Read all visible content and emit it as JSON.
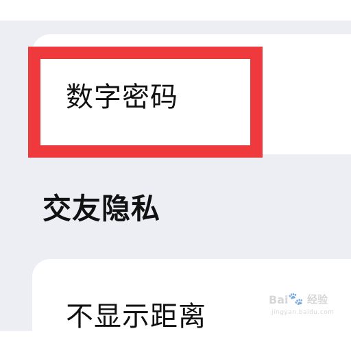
{
  "privacy_settings": {
    "top_card": {
      "digital_password_label": "数字密码"
    },
    "social_privacy_section": {
      "title": "交友隐私",
      "items": [
        {
          "label": "不显示距离"
        }
      ]
    }
  },
  "annotation": {
    "highlight_color": "#ee3a3c"
  },
  "watermark": {
    "brand": "Bai",
    "paw": "🐾",
    "jingyan": "经验",
    "url": "jingyan.baidu.com"
  },
  "colors": {
    "page_background": "#edeef4",
    "card_background": "#ffffff",
    "text": "#111111"
  }
}
